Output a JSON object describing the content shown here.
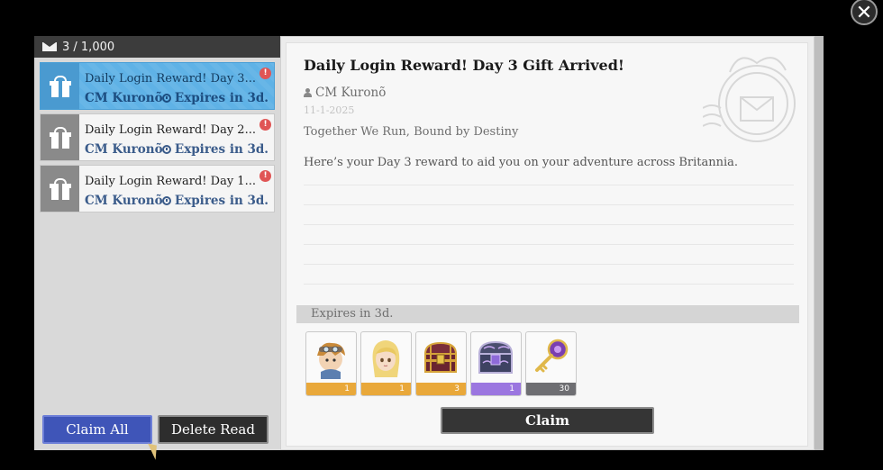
{
  "mailbox": {
    "count": "3 / 1,000"
  },
  "mails": [
    {
      "title": "Daily Login Reward! Day 3...",
      "sender": "CM Kuronõ",
      "expiry": "Expires in 3d.",
      "badge": "!"
    },
    {
      "title": "Daily Login Reward! Day 2...",
      "sender": "CM Kuronõ",
      "expiry": "Expires in 3d.",
      "badge": "!"
    },
    {
      "title": "Daily Login Reward! Day 1...",
      "sender": "CM Kuronõ",
      "expiry": "Expires in 3d.",
      "badge": "!"
    }
  ],
  "buttons": {
    "claim_all": "Claim All",
    "delete_read": "Delete Read",
    "claim": "Claim",
    "close": "✕"
  },
  "detail": {
    "title": "Daily Login Reward! Day 3 Gift Arrived!",
    "sender": "CM Kuronõ",
    "date": "11-1-2025",
    "subject": "Together We Run, Bound by Destiny",
    "body": "Here’s your Day 3 reward to aid you on your adventure across Britannia.",
    "expiry": "Expires in 3d."
  },
  "rewards": [
    {
      "icon": "character-boy-icon",
      "qty": "1",
      "rarity_color": "#e9a83a"
    },
    {
      "icon": "character-girl-icon",
      "qty": "1",
      "rarity_color": "#e9a83a"
    },
    {
      "icon": "treasure-chest-icon",
      "qty": "3",
      "rarity_color": "#e9a83a"
    },
    {
      "icon": "purple-chest-icon",
      "qty": "1",
      "rarity_color": "#9b76e0"
    },
    {
      "icon": "key-icon",
      "qty": "30",
      "rarity_color": "#6e6e72"
    }
  ],
  "colors": {
    "selected_item": "#5fb2e6",
    "claim_all_button": "#3f55b8",
    "dark_button": "#2d2d2d",
    "alert_badge": "#e05555"
  }
}
